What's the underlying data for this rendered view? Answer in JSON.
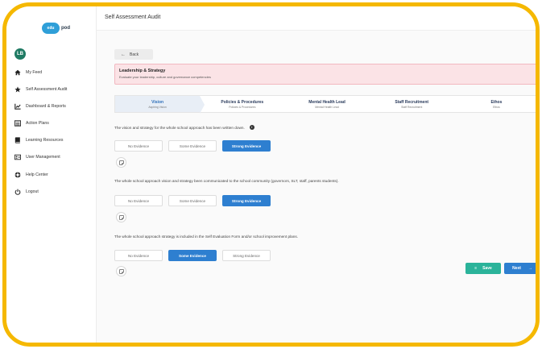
{
  "app": {
    "logo_text": "pod",
    "logo_badge": "edu",
    "page_title": "Self Assessment Audit"
  },
  "user": {
    "initials": "LB"
  },
  "sidebar": {
    "items": [
      {
        "label": "My Feed",
        "icon": "home-icon"
      },
      {
        "label": "Self Assessment Audit",
        "icon": "star-icon"
      },
      {
        "label": "Dashboard & Reports",
        "icon": "chart-icon"
      },
      {
        "label": "Action Plans",
        "icon": "list-icon"
      },
      {
        "label": "Learning Resources",
        "icon": "book-icon"
      },
      {
        "label": "User Management",
        "icon": "user-card-icon"
      },
      {
        "label": "Help Center",
        "icon": "help-icon"
      },
      {
        "label": "Logout",
        "icon": "power-icon"
      }
    ]
  },
  "back_label": "Back",
  "section": {
    "title": "Leadership & Strategy",
    "subtitle": "Evaluate your leadership, culture and governance competencies"
  },
  "steps": [
    {
      "title": "Vision",
      "subtitle": "Aspiring Vision",
      "active": true
    },
    {
      "title": "Policies & Procedures",
      "subtitle": "Policies & Procedures",
      "active": false
    },
    {
      "title": "Mental Health Lead",
      "subtitle": "Mental Health Lead",
      "active": false
    },
    {
      "title": "Staff Recruitment",
      "subtitle": "Staff Recruitment",
      "active": false
    },
    {
      "title": "Ethos",
      "subtitle": "Ethos",
      "active": false
    }
  ],
  "evidence_options": [
    "No Evidence",
    "Some Evidence",
    "Strong Evidence"
  ],
  "questions": [
    {
      "text": "The vision and strategy for the whole school approach has been written down.",
      "selected": "Strong Evidence",
      "has_info": true
    },
    {
      "text": "The whole school approach vision and strategy been communicated to the school community (governors, SLT, staff, parents students).",
      "selected": "Strong Evidence",
      "has_info": false
    },
    {
      "text": "The whole school approach strategy is included in the Self Evaluation Form and/or school improvement plans.",
      "selected": "Some Evidence",
      "has_info": false
    }
  ],
  "actions": {
    "save_label": "Save",
    "next_label": "Next"
  },
  "colors": {
    "frame": "#f5b800",
    "primary": "#2e7fd0",
    "save": "#2bb39a",
    "banner_bg": "#fbe3e6"
  }
}
